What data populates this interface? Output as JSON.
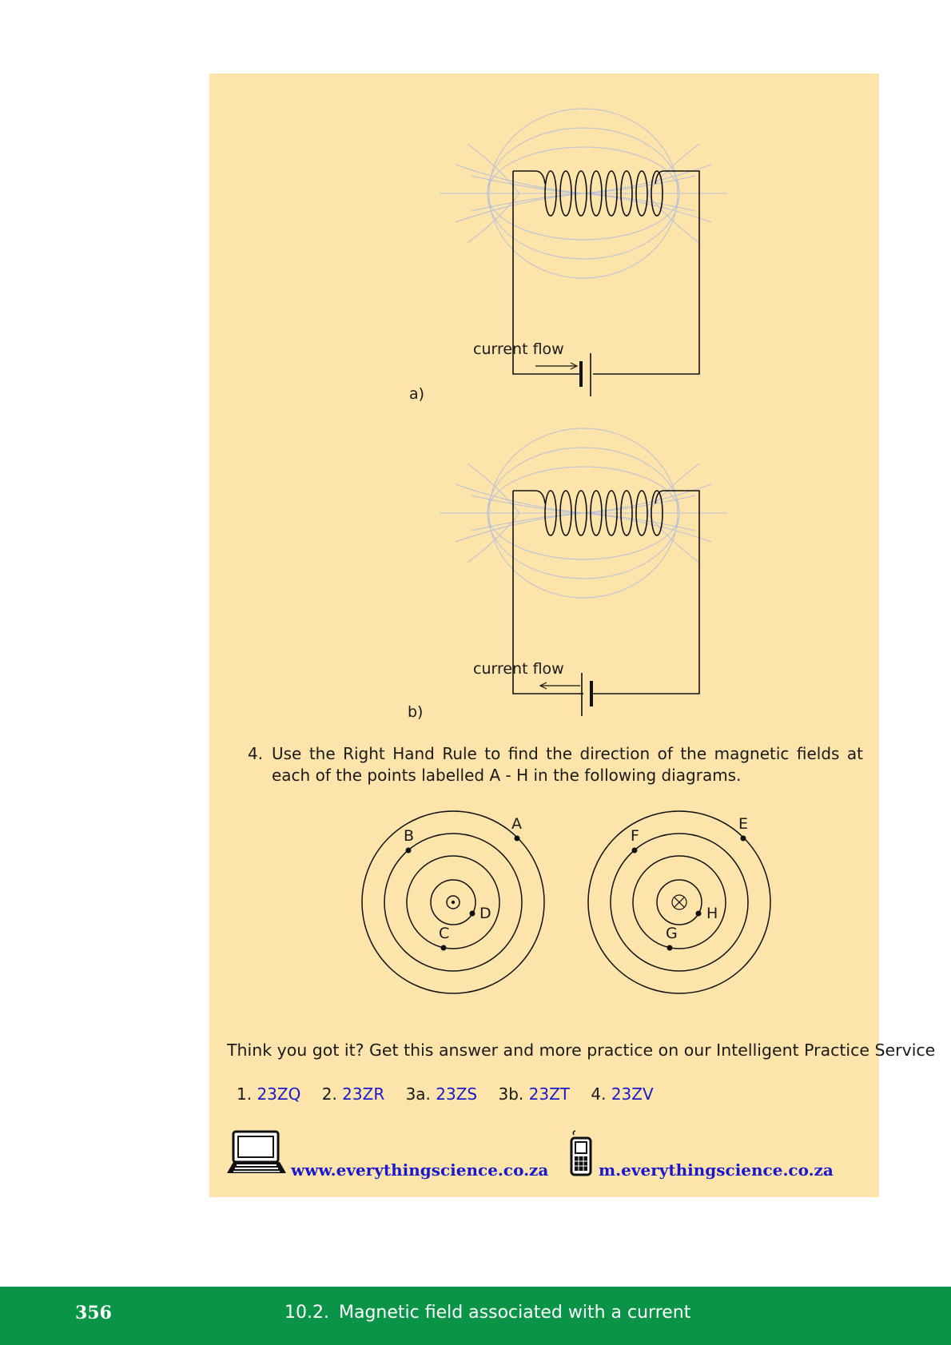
{
  "figures": {
    "a": {
      "label": "a)",
      "flow_label": "current flow"
    },
    "b": {
      "label": "b)",
      "flow_label": "current flow"
    }
  },
  "question4": {
    "number": "4.",
    "text": "Use the Right Hand Rule to find the direction of the magnetic fields at each of the points labelled A - H in the following diagrams."
  },
  "wire_left": {
    "points": [
      "A",
      "B",
      "C",
      "D"
    ],
    "symbol": "out-of-page-dot"
  },
  "wire_right": {
    "points": [
      "E",
      "F",
      "G",
      "H"
    ],
    "symbol": "into-page-cross"
  },
  "practice": {
    "prompt": "Think you got it? Get this answer and more practice on our Intelligent Practice Service",
    "codes": [
      {
        "label": "1.",
        "code": "23ZQ"
      },
      {
        "label": "2.",
        "code": "23ZR"
      },
      {
        "label": "3a.",
        "code": "23ZS"
      },
      {
        "label": "3b.",
        "code": "23ZT"
      },
      {
        "label": "4.",
        "code": "23ZV"
      }
    ]
  },
  "links": {
    "web": {
      "icon": "laptop-icon",
      "text": "www.everythingscience.co.za"
    },
    "mobile": {
      "icon": "mobile-phone-icon",
      "text": "m.everythingscience.co.za"
    }
  },
  "footer": {
    "page_number": "356",
    "section_number": "10.2.",
    "section_title": "Magnetic field associated with a current",
    "color": "#0a9447"
  },
  "colors": {
    "box_background": "#fce4ab",
    "link": "#1a1acc",
    "field_lines": "#b8c0d8"
  }
}
